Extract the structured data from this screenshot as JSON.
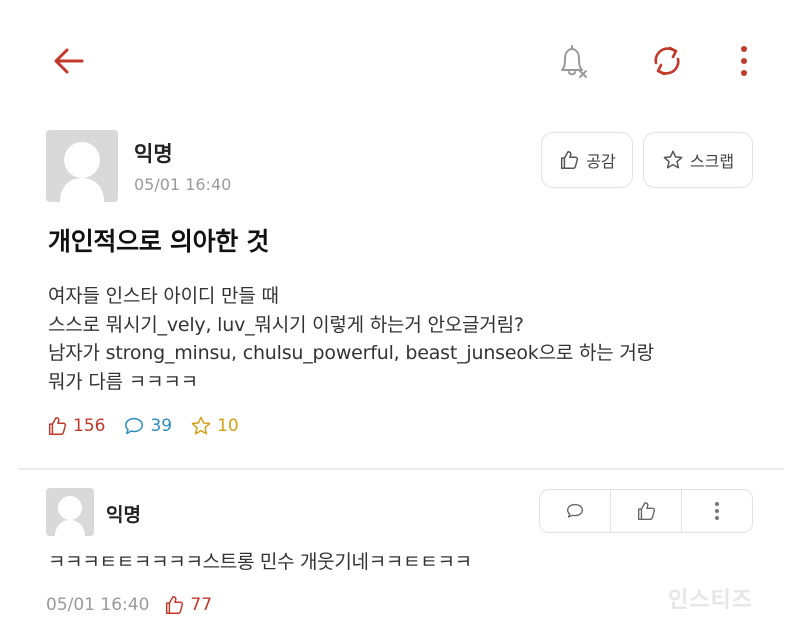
{
  "colors": {
    "accent": "#c0392b",
    "comment_stat": "#2b8bbf",
    "scrap_stat": "#d4a017",
    "muted": "#9a9a9a"
  },
  "topbar": {
    "back_icon": "arrow-left-icon",
    "notification_icon": "bell-off-icon",
    "refresh_icon": "refresh-icon",
    "more_icon": "more-vertical-icon"
  },
  "post": {
    "author": "익명",
    "date": "05/01 16:40",
    "like_button_label": "공감",
    "scrap_button_label": "스크랩",
    "title": "개인적으로 의아한 것",
    "body_lines": [
      "여자들 인스타 아이디 만들 때",
      "스스로 뭐시기_vely, luv_뭐시기 이렇게 하는거 안오글거림?",
      "남자가 strong_minsu, chulsu_powerful, beast_junseok으로 하는 거랑",
      "뭐가 다름 ㅋㅋㅋㅋ"
    ],
    "stats": {
      "likes": "156",
      "comments": "39",
      "scraps": "10"
    }
  },
  "comment": {
    "author": "익명",
    "text": "ㅋㅋㅋㅌㅌㅋㅋㅋㅋ스트롱 민수 개웃기네ㅋㅋㅌㅌㅋㅋ",
    "date": "05/01 16:40",
    "likes": "77"
  },
  "watermark": "인스티즈"
}
